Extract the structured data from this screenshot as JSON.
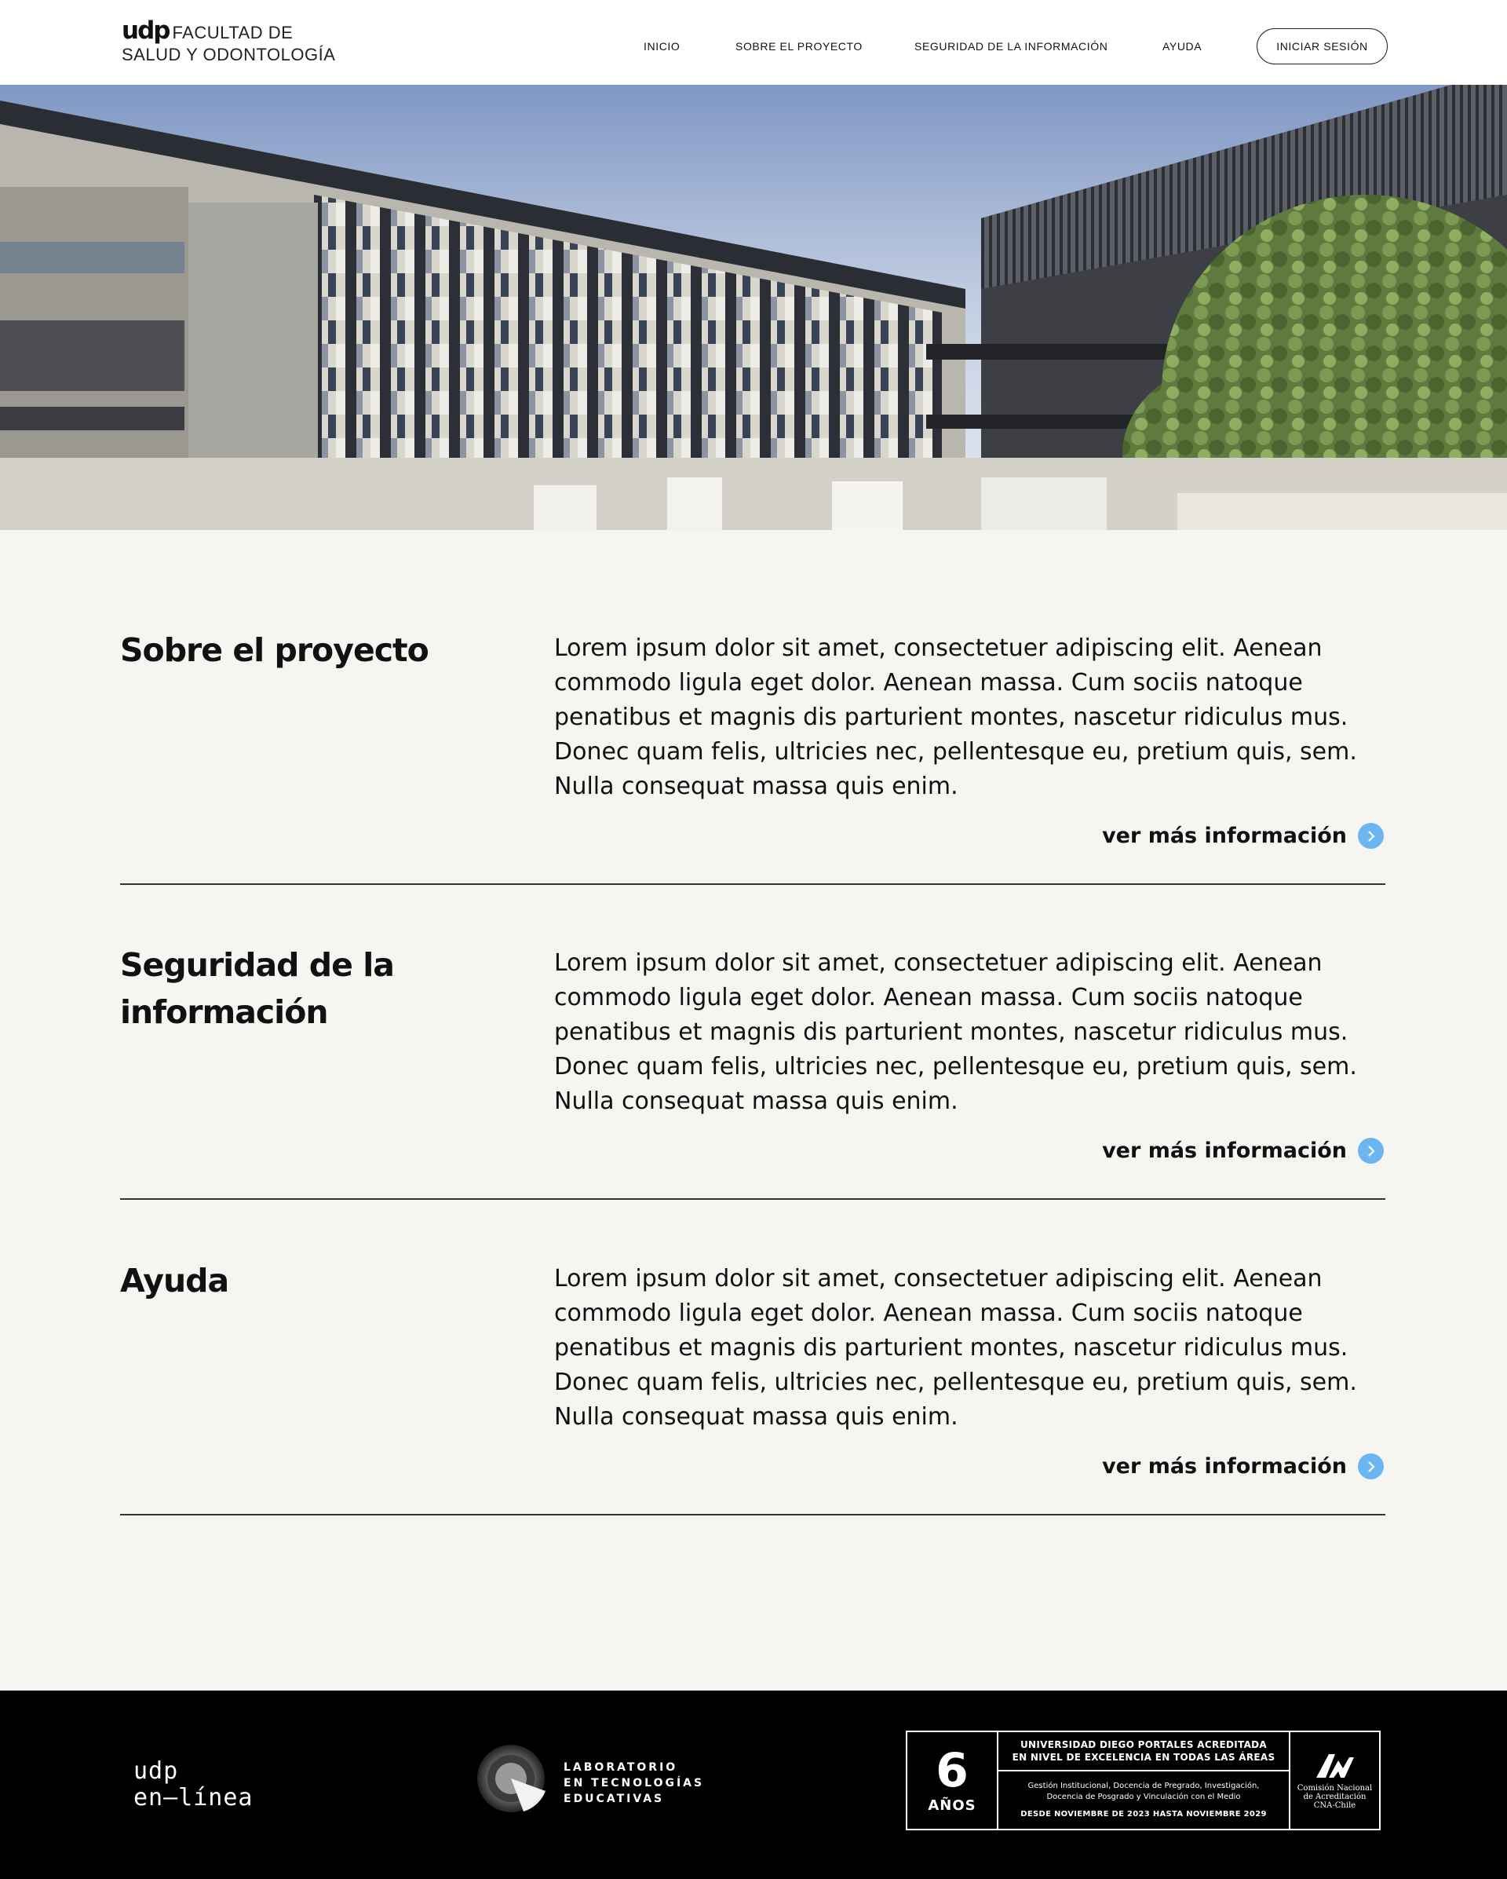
{
  "header": {
    "logo_brand": "udp",
    "logo_line1": "FACULTAD DE",
    "logo_line2": "SALUD Y ODONTOLOGÍA",
    "nav": [
      "INICIO",
      "SOBRE EL PROYECTO",
      "SEGURIDAD DE LA INFORMACIÓN",
      "AYUDA"
    ],
    "login_label": "INICIAR SESIÓN"
  },
  "hero": {
    "icon": "building-photo"
  },
  "sections": [
    {
      "title": "Sobre el proyecto",
      "body": "Lorem ipsum dolor sit amet, consectetuer adipiscing elit. Aenean commodo ligula eget dolor. Aenean massa. Cum sociis natoque penatibus et magnis dis parturient montes, nascetur ridiculus mus. Donec quam felis, ultricies nec, pellentesque eu, pretium quis, sem. Nulla consequat massa quis enim.",
      "more_label": "ver más información"
    },
    {
      "title": "Seguridad de la información",
      "body": "Lorem ipsum dolor sit amet, consectetuer adipiscing elit. Aenean commodo ligula eget dolor. Aenean massa. Cum sociis natoque penatibus et magnis dis parturient montes, nascetur ridiculus mus. Donec quam felis, ultricies nec, pellentesque eu, pretium quis, sem. Nulla consequat massa quis enim.",
      "more_label": "ver más información"
    },
    {
      "title": "Ayuda",
      "body": "Lorem ipsum dolor sit amet, consectetuer adipiscing elit. Aenean commodo ligula eget dolor. Aenean massa. Cum sociis natoque penatibus et magnis dis parturient montes, nascetur ridiculus mus. Donec quam felis, ultricies nec, pellentesque eu, pretium quis, sem. Nulla consequat massa quis enim.",
      "more_label": "ver más información"
    }
  ],
  "footer": {
    "udp_line1": "udp",
    "udp_line2": "en—línea",
    "lab_line1": "LABORATORIO",
    "lab_line2": "EN TECNOLOGÍAS",
    "lab_line3": "EDUCATIVAS",
    "badge": {
      "number": "6",
      "years": "AÑOS",
      "headline1": "UNIVERSIDAD DIEGO PORTALES ACREDITADA",
      "headline2": "EN NIVEL DE EXCELENCIA EN TODAS LAS ÁREAS",
      "areas1": "Gestión Institucional, Docencia de Pregrado, Investigación,",
      "areas2": "Docencia de Posgrado y Vinculación con el Medio",
      "dates": "DESDE NOVIEMBRE DE 2023 HASTA NOVIEMBRE 2029",
      "cna1": "Comisión Nacional",
      "cna2": "de Acreditación",
      "cna3": "CNA-Chile"
    }
  },
  "colors": {
    "accent": "#6bb6f0",
    "background": "#f6f5f2",
    "footer": "#000000"
  }
}
